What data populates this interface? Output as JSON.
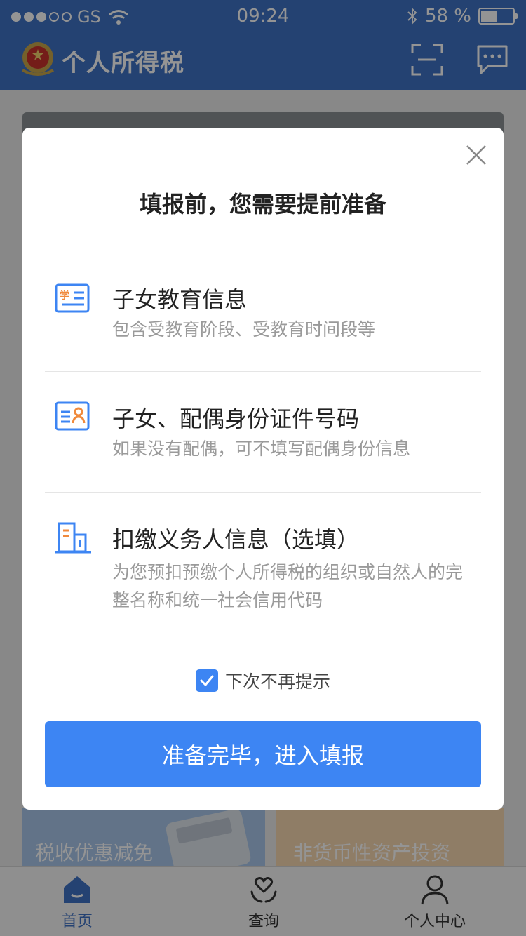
{
  "status_bar": {
    "carrier": "GS",
    "time": "09:24",
    "battery": "58 %"
  },
  "app_bar": {
    "title": "个人所得税"
  },
  "cards": [
    {
      "label": "税收优惠减免"
    },
    {
      "label": "非货币性资产投资"
    }
  ],
  "tab_bar": {
    "items": [
      {
        "label": "首页",
        "icon": "home-icon"
      },
      {
        "label": "查询",
        "icon": "heart-hands-icon"
      },
      {
        "label": "个人中心",
        "icon": "person-icon"
      }
    ]
  },
  "modal": {
    "title": "填报前，您需要提前准备",
    "items": [
      {
        "icon": "education-card-icon",
        "badge": "学",
        "title": "子女教育信息",
        "desc": "包含受教育阶段、受教育时间段等"
      },
      {
        "icon": "id-card-icon",
        "title": "子女、配偶身份证件号码",
        "desc": "如果没有配偶，可不填写配偶身份信息"
      },
      {
        "icon": "building-icon",
        "title": "扣缴义务人信息（选填）",
        "desc": "为您预扣预缴个人所得税的组织或自然人的完整名称和统一社会信用代码"
      }
    ],
    "checkbox_label": "下次不再提示",
    "checkbox_checked": true,
    "button_label": "准备完毕，进入填报"
  },
  "colors": {
    "primary": "#3d85f3",
    "header": "#3f72c4",
    "accent_orange": "#f08a3c"
  }
}
